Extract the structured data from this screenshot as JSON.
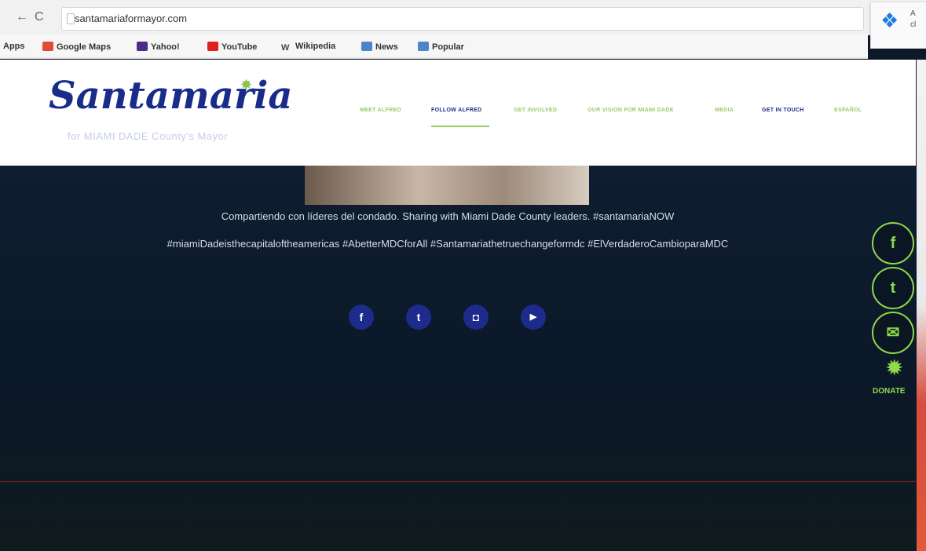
{
  "browser": {
    "url": "santamariaformayor.com",
    "back_icon": "back-arrow-icon",
    "reload_icon": "reload-icon",
    "bookmarks": [
      {
        "label": "Apps",
        "icon": "apps-icon",
        "color": "#ffffff"
      },
      {
        "label": "Google Maps",
        "icon": "maps-icon",
        "color": "#e24a3a"
      },
      {
        "label": "Yahoo!",
        "icon": "yahoo-icon",
        "color": "#4b2b8c"
      },
      {
        "label": "YouTube",
        "icon": "youtube-icon",
        "color": "#e02020"
      },
      {
        "label": "Wikipedia",
        "icon": "wikipedia-icon",
        "color": "#ffffff"
      },
      {
        "label": "News",
        "icon": "folder-icon",
        "color": "#4a86c8"
      },
      {
        "label": "Popular",
        "icon": "folder-icon",
        "color": "#4a86c8"
      }
    ],
    "extension": {
      "icon": "dropbox-icon",
      "text_line1": "A",
      "text_line2": "cl"
    }
  },
  "site": {
    "logo": "Santamaria",
    "tagline": "for MIAMI DADE County's Mayor",
    "menu": [
      {
        "label": "Meet Alfred",
        "state": "normal"
      },
      {
        "label": "Follow Alfred",
        "state": "active"
      },
      {
        "label": "Get Involved",
        "state": "normal"
      },
      {
        "label": "Our Vision for Miami Dade",
        "state": "normal"
      },
      {
        "label": "Media",
        "state": "normal"
      },
      {
        "label": "Get in Touch",
        "state": "dark"
      },
      {
        "label": "Español",
        "state": "normal"
      }
    ],
    "colors": {
      "brand_blue": "#1a2c8a",
      "accent_green": "#8fd94a"
    }
  },
  "hero": {
    "caption_line1": "Compartiendo con líderes del condado. Sharing with Miami Dade County leaders. #santamariaNOW",
    "caption_line2": "#miamiDadeisthecapitaloftheamericas #AbetterMDCforAll #Santamariathetruechangeformdc #ElVerdaderoCambioparaMDC",
    "social": [
      {
        "icon": "facebook-icon",
        "glyph": "f"
      },
      {
        "icon": "twitter-icon",
        "glyph": "t"
      },
      {
        "icon": "instagram-icon",
        "glyph": "◘"
      },
      {
        "icon": "youtube-icon",
        "glyph": "▶"
      }
    ]
  },
  "sidebar": {
    "buttons": [
      {
        "icon": "facebook-icon",
        "glyph": "f"
      },
      {
        "icon": "twitter-icon",
        "glyph": "t"
      },
      {
        "icon": "mail-icon",
        "glyph": "✉"
      }
    ],
    "donate_label": "DONATE"
  }
}
